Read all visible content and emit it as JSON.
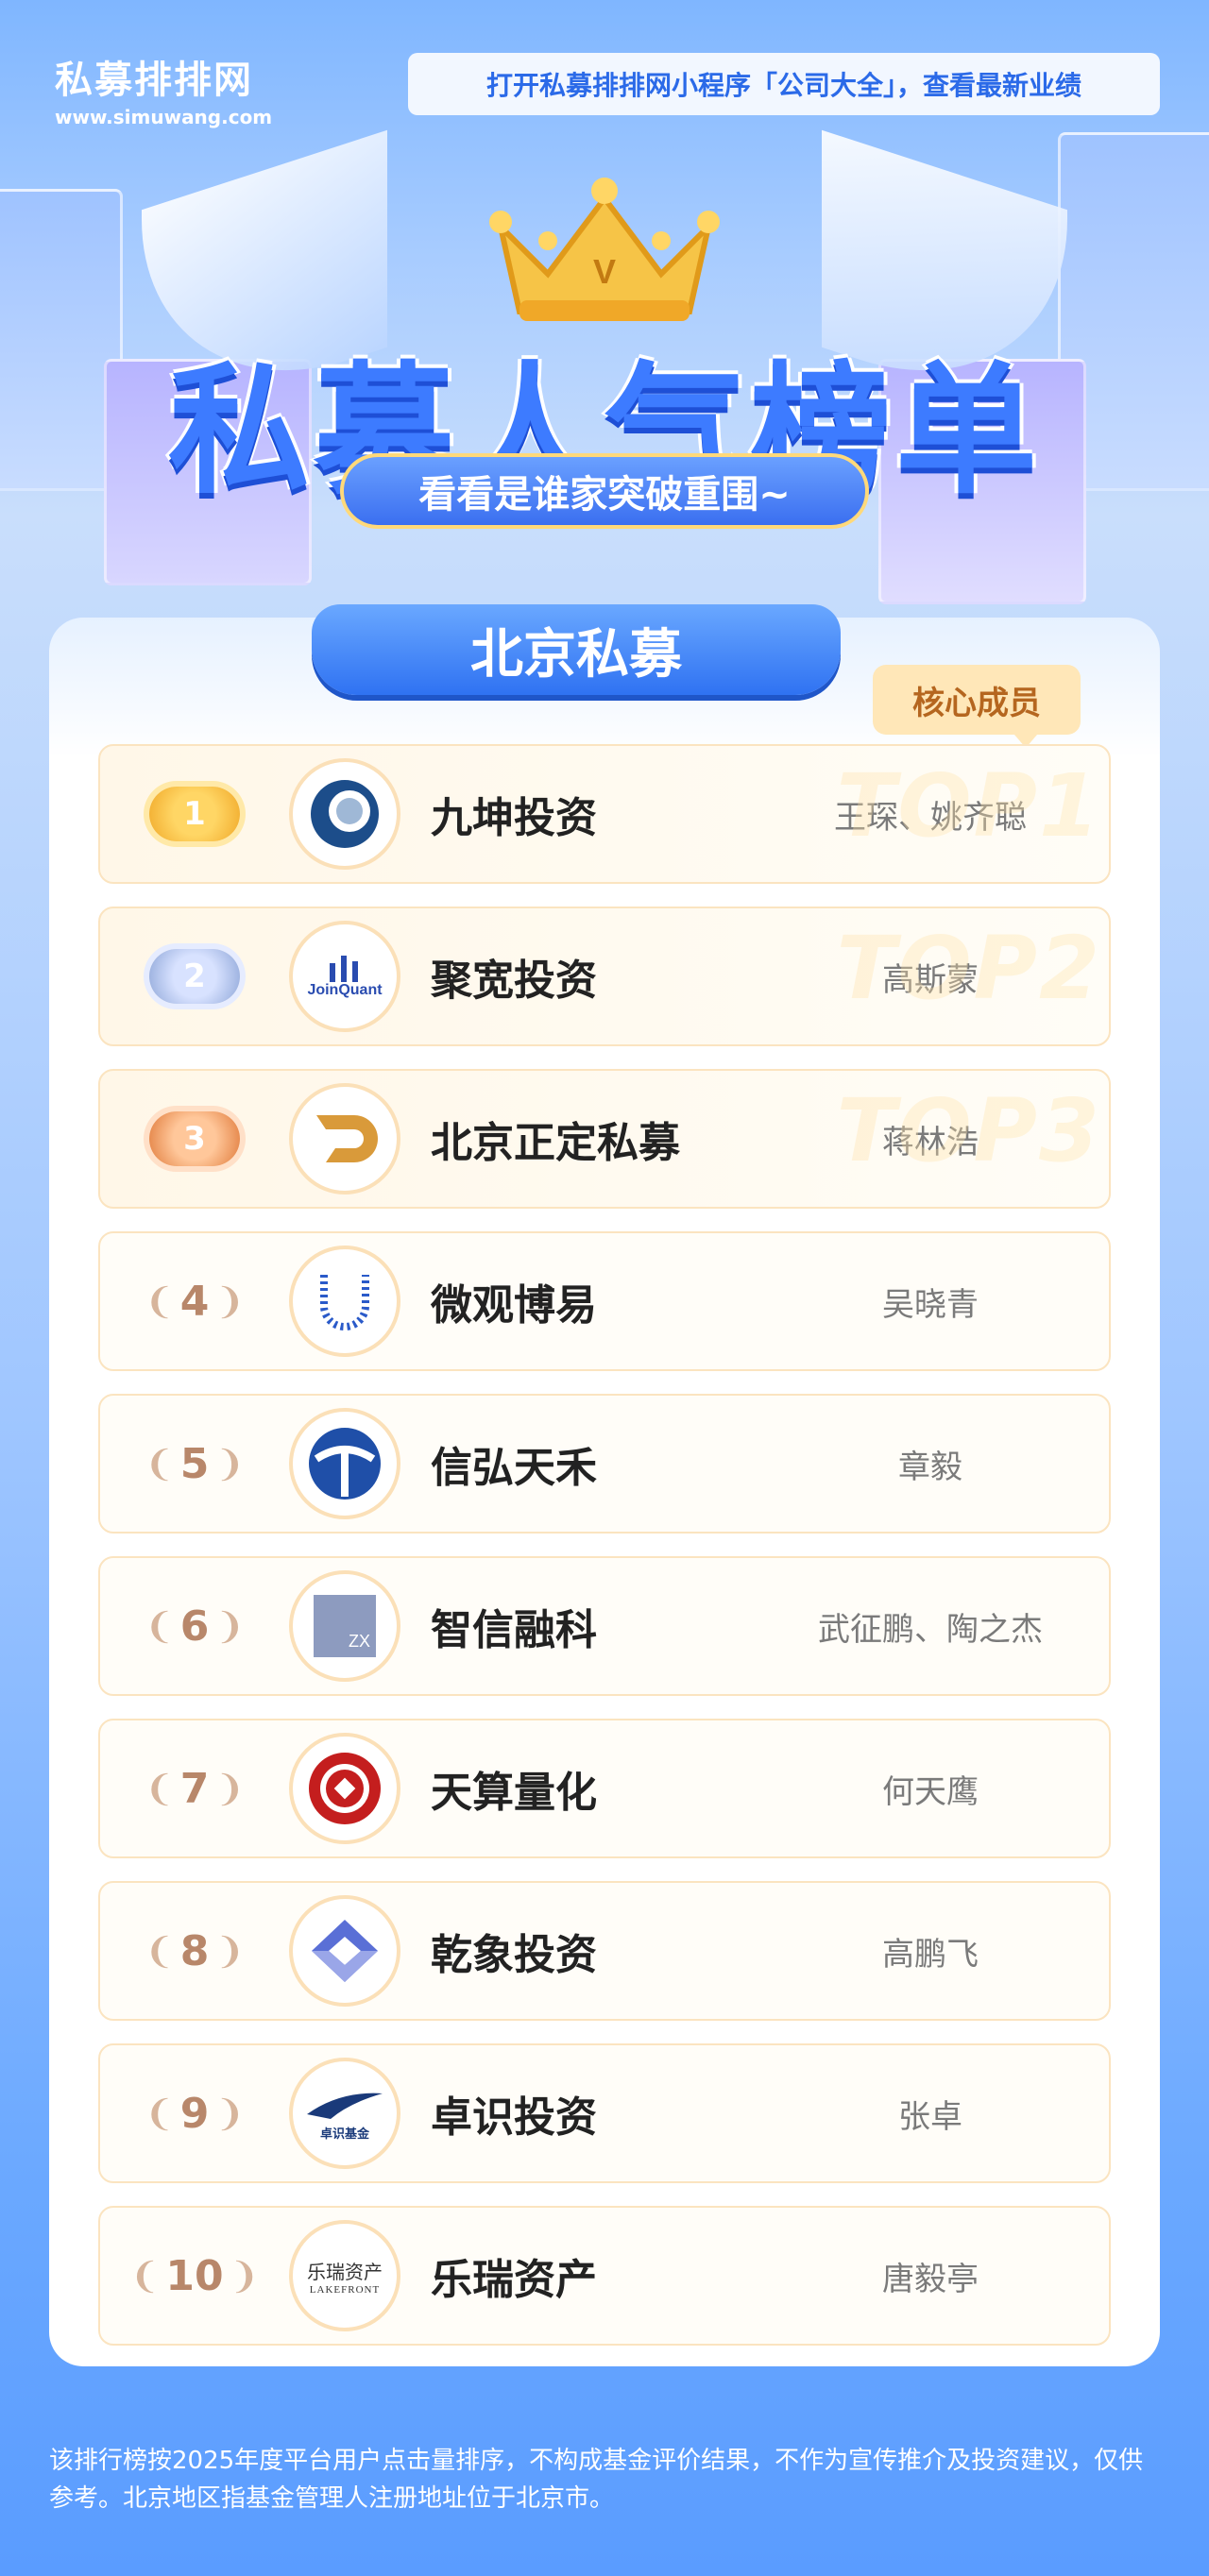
{
  "header": {
    "brand_name": "私募排排网",
    "brand_url": "www.simuwang.com",
    "promo_text": "打开私募排排网小程序「公司大全」，查看最新业绩"
  },
  "hero": {
    "title": "私募人气榜单",
    "subtitle": "看看是谁家突破重围~"
  },
  "card": {
    "region_title": "北京私募",
    "core_member_tag": "核心成员"
  },
  "rankings": [
    {
      "rank": "1",
      "company": "九坤投资",
      "members": "王琛、姚齐聪",
      "watermark": "TOP1"
    },
    {
      "rank": "2",
      "company": "聚宽投资",
      "members": "高斯蒙",
      "watermark": "TOP2",
      "logo_text": "JoinQuant"
    },
    {
      "rank": "3",
      "company": "北京正定私募",
      "members": "蒋林浩",
      "watermark": "TOP3"
    },
    {
      "rank": "4",
      "company": "微观博易",
      "members": "吴晓青"
    },
    {
      "rank": "5",
      "company": "信弘天禾",
      "members": "章毅"
    },
    {
      "rank": "6",
      "company": "智信融科",
      "members": "武征鹏、陶之杰",
      "logo_text": "ZX"
    },
    {
      "rank": "7",
      "company": "天算量化",
      "members": "何天鹰"
    },
    {
      "rank": "8",
      "company": "乾象投资",
      "members": "高鹏飞"
    },
    {
      "rank": "9",
      "company": "卓识投资",
      "members": "张卓",
      "logo_text": "卓识基金"
    },
    {
      "rank": "10",
      "company": "乐瑞资产",
      "members": "唐毅亭",
      "logo_text": "乐瑞资产",
      "logo_subtext": "LAKEFRONT"
    }
  ],
  "footnote": "该排行榜按2025年度平台用户点击量排序，不构成基金评价结果，不作为宣传推介及投资建议，仅供参考。北京地区指基金管理人注册地址位于北京市。",
  "colors": {
    "brand_blue": "#2f72f2",
    "gold": "#f0a828",
    "core_tag_bg": "#ffe7b8"
  }
}
